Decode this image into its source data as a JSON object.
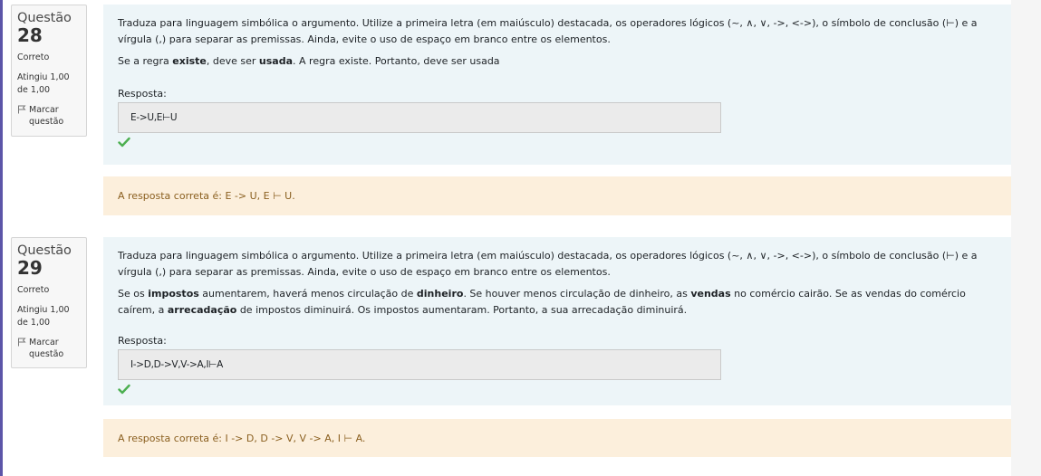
{
  "questions": [
    {
      "label": "Questão",
      "number": "28",
      "state": "Correto",
      "grade": "Atingiu 1,00 de 1,00",
      "flag": "Marcar questão",
      "instructions": "Traduza para linguagem simbólica o argumento. Utilize a primeira letra (em maiúsculo) destacada, os operadores lógicos (~, ∧, ∨, ->, <->), o símbolo de conclusão (⊢) e  a vírgula (,) para separar as premissas. Ainda, evite o uso de espaço em branco entre os elementos.",
      "argument": [
        {
          "t": "Se a regra "
        },
        {
          "t": "existe",
          "b": true
        },
        {
          "t": ", deve ser "
        },
        {
          "t": "usada",
          "b": true
        },
        {
          "t": ". A regra existe. Portanto, deve ser usada"
        }
      ],
      "response_label": "Resposta:",
      "response_value": "E->U,E⊢U",
      "feedback": "A resposta correta é: E -> U, E ⊢ U."
    },
    {
      "label": "Questão",
      "number": "29",
      "state": "Correto",
      "grade": "Atingiu 1,00 de 1,00",
      "flag": "Marcar questão",
      "instructions": "Traduza para linguagem simbólica o argumento. Utilize a primeira letra (em maiúsculo) destacada, os operadores lógicos (~, ∧, ∨, ->, <->), o símbolo de conclusão (⊢) e  a vírgula (,) para separar as premissas. Ainda, evite o uso de espaço em branco entre os elementos.",
      "argument": [
        {
          "t": "Se os "
        },
        {
          "t": "impostos",
          "b": true
        },
        {
          "t": " aumentarem, haverá menos circulação de "
        },
        {
          "t": "dinheiro",
          "b": true
        },
        {
          "t": ". Se houver menos circulação de dinheiro, as "
        },
        {
          "t": "vendas",
          "b": true
        },
        {
          "t": " no comércio cairão. Se as vendas do comércio caírem, a "
        },
        {
          "t": "arrecadação",
          "b": true
        },
        {
          "t": " de impostos diminuirá. Os impostos aumentaram. Portanto, a sua arrecadação diminuirá."
        }
      ],
      "response_label": "Resposta:",
      "response_value": "I->D,D->V,V->A,I⊢A",
      "feedback": "A resposta correta é: I -> D, D -> V, V -> A, I ⊢ A."
    }
  ],
  "colors": {
    "content_bg": "#edf5f8",
    "feedback_bg": "#fcefdc",
    "feedback_text": "#8a5f1f",
    "correct_check": "#4caf50"
  }
}
